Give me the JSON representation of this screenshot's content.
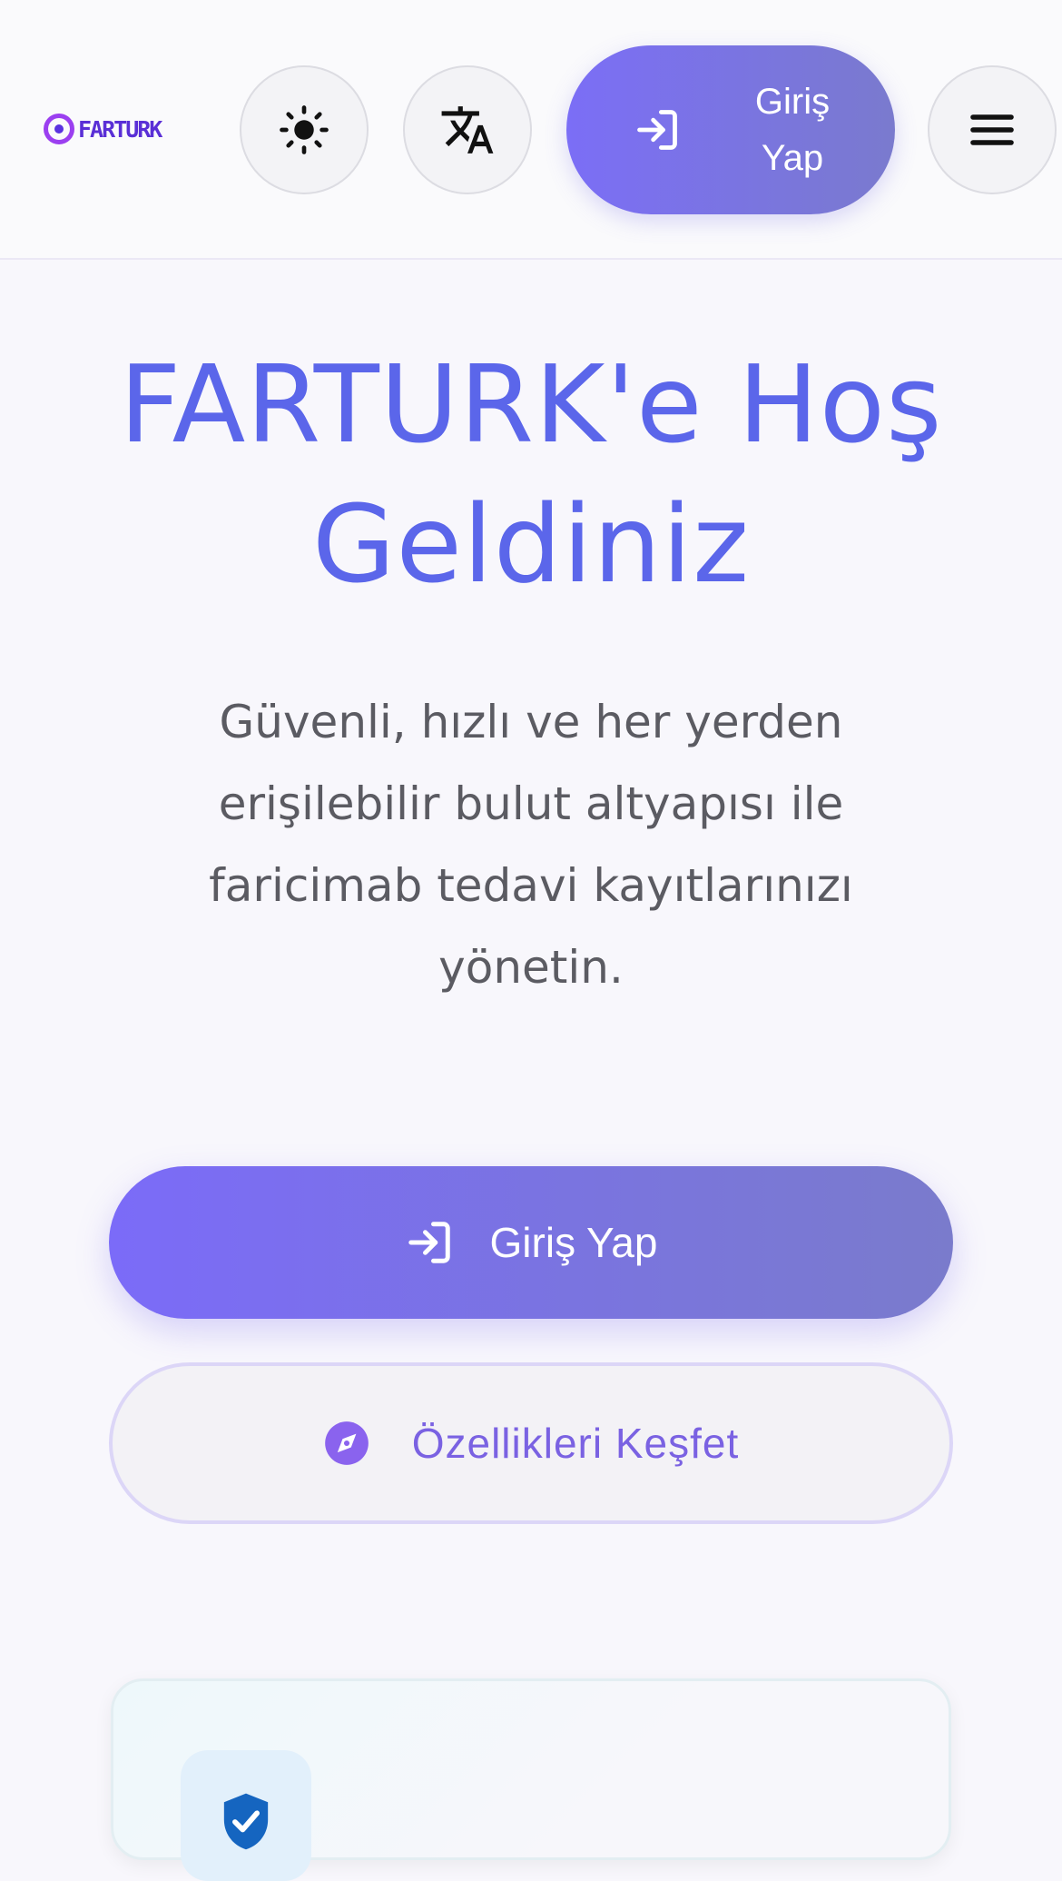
{
  "header": {
    "logo_text": "FARTURK",
    "theme_toggle_icon": "sun-icon",
    "language_icon": "translate-icon",
    "login_icon": "login-icon",
    "login_label_line1": "Giriş",
    "login_label_line2": "Yap",
    "menu_icon": "hamburger-menu-icon"
  },
  "hero": {
    "title_line1": "FARTURK'e Hoş",
    "title_line2": "Geldiniz",
    "description_lines": [
      "Güvenli, hızlı ve her yerden",
      "erişilebilir bulut altyapısı ile",
      "faricimab tedavi kayıtlarınızı",
      "yönetin."
    ]
  },
  "actions": {
    "primary_label": "Giriş Yap",
    "primary_icon": "login-icon",
    "secondary_label": "Özellikleri Keşfet",
    "secondary_icon": "compass-icon"
  },
  "feature_card": {
    "icon": "shield-check-icon"
  },
  "colors": {
    "accent": "#7b6ef6",
    "title": "#5b66ea",
    "secondary_text": "#7a62e2"
  }
}
